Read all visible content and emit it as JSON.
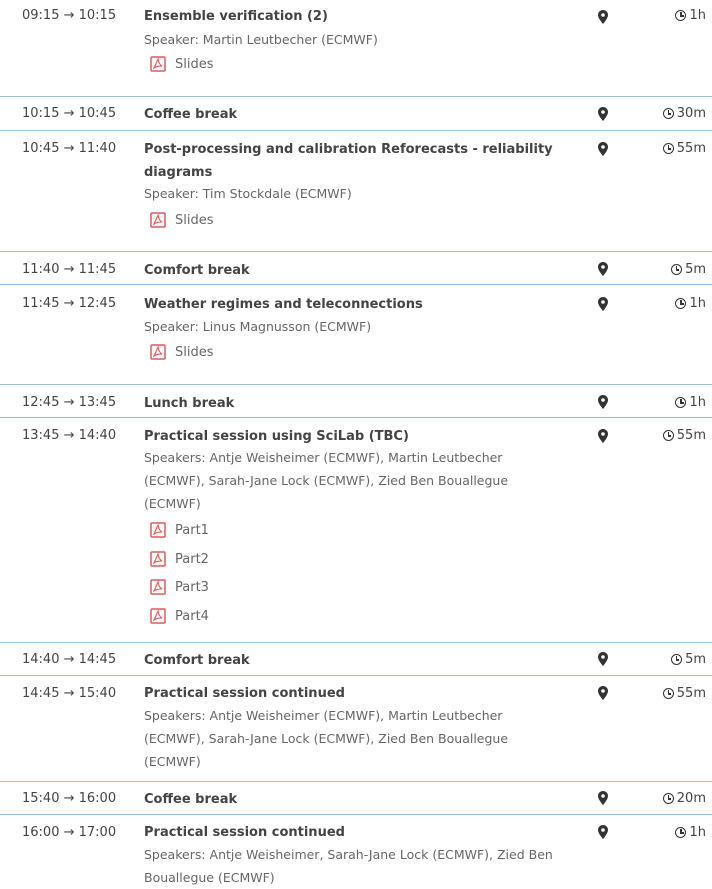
{
  "entries": [
    {
      "time": "09:15 → 10:15",
      "title": "Ensemble verification (2)",
      "speaker": "Speaker: Martin Leutbecher (ECMWF)",
      "duration": "1h",
      "materials": [
        "Slides"
      ]
    },
    {
      "time": "10:15 → 10:45",
      "title": "Coffee break",
      "duration": "30m"
    },
    {
      "time": "10:45 → 11:40",
      "title": "Post-processing and calibration Reforecasts - reliability diagrams",
      "speaker": "Speaker: Tim Stockdale (ECMWF)",
      "duration": "55m",
      "materials": [
        "Slides"
      ]
    },
    {
      "time": "11:40 → 11:45",
      "title": "Comfort break",
      "duration": "5m"
    },
    {
      "time": "11:45 → 12:45",
      "title": "Weather regimes and teleconnections",
      "speaker": "Speaker: Linus Magnusson (ECMWF)",
      "duration": "1h",
      "materials": [
        "Slides"
      ]
    },
    {
      "time": "12:45 → 13:45",
      "title": "Lunch break",
      "duration": "1h"
    },
    {
      "time": "13:45 → 14:40",
      "title": "Practical session using SciLab (TBC)",
      "speaker": "Speakers: Antje Weisheimer (ECMWF), Martin Leutbecher (ECMWF), Sarah-Jane Lock (ECMWF), Zied Ben Bouallegue (ECMWF)",
      "duration": "55m",
      "materials": [
        "Part1",
        "Part2",
        "Part3",
        "Part4"
      ]
    },
    {
      "time": "14:40 → 14:45",
      "title": "Comfort break",
      "duration": "5m"
    },
    {
      "time": "14:45 → 15:40",
      "title": "Practical session continued",
      "speaker": "Speakers: Antje Weisheimer (ECMWF), Martin Leutbecher (ECMWF), Sarah-Jane Lock (ECMWF), Zied Ben Bouallegue (ECMWF)",
      "duration": "55m"
    },
    {
      "time": "15:40 → 16:00",
      "title": "Coffee break",
      "duration": "20m"
    },
    {
      "time": "16:00 → 17:00",
      "title": "Practical session continued",
      "speaker": "Speakers: Antje Weisheimer, Sarah-Jane Lock (ECMWF), Zied Ben Bouallegue (ECMWF)",
      "duration": "1h"
    }
  ],
  "icons": {
    "location": "map-marker-icon",
    "duration": "clock-icon",
    "material": "pdf-file-icon"
  },
  "colors": {
    "separator": "#9ec3df",
    "pdf": "#e05a5a"
  }
}
